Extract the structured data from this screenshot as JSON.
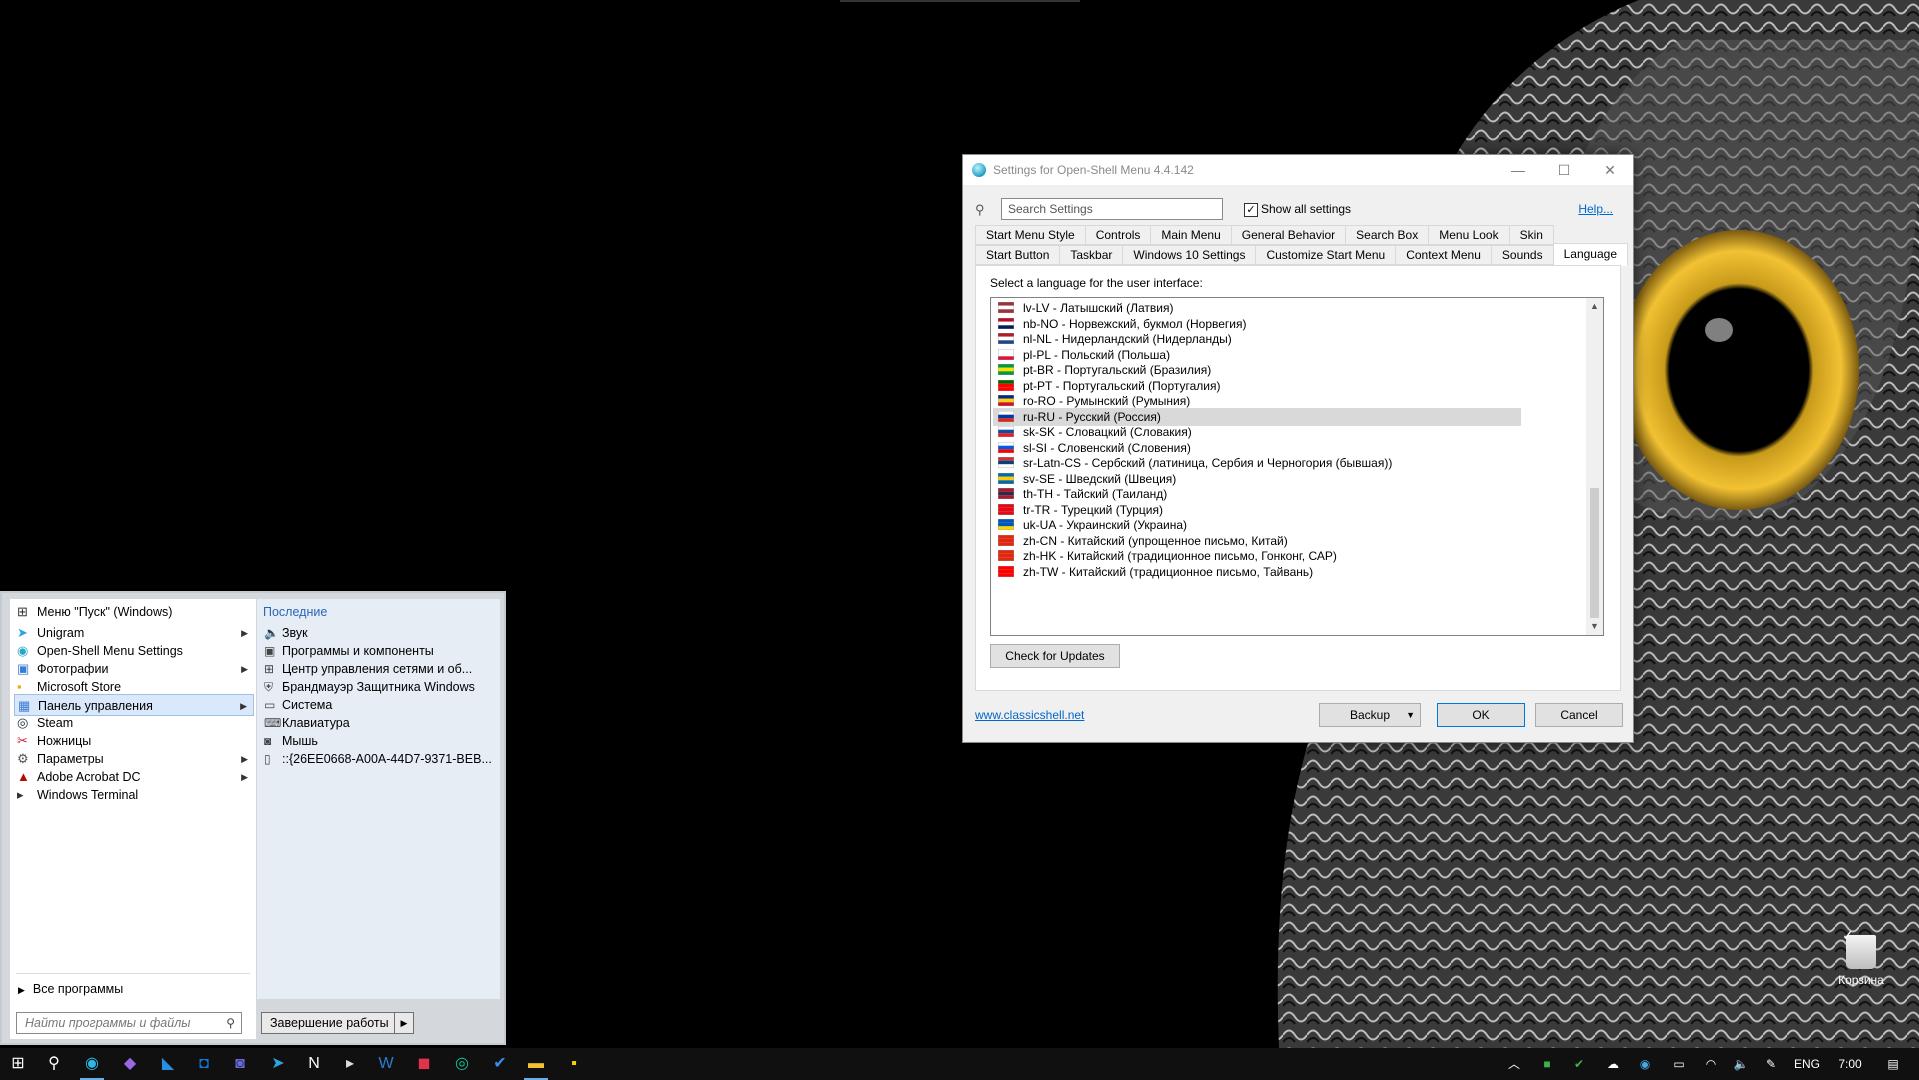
{
  "settings_window": {
    "title": "Settings for Open-Shell Menu 4.4.142",
    "search_placeholder": "Search Settings",
    "show_all_label": "Show all settings",
    "help_link": "Help...",
    "tabs_row1": [
      "Start Menu Style",
      "Controls",
      "Main Menu",
      "General Behavior",
      "Search Box",
      "Menu Look",
      "Skin"
    ],
    "tabs_row2": [
      "Start Button",
      "Taskbar",
      "Windows 10 Settings",
      "Customize Start Menu",
      "Context Menu",
      "Sounds",
      "Language"
    ],
    "active_tab": "Language",
    "panel_label": "Select a language for the user interface:",
    "languages": [
      {
        "text": "lv-LV - Латышский (Латвия)",
        "flag": [
          "#9e3039",
          "#ffffff",
          "#9e3039"
        ]
      },
      {
        "text": "nb-NO - Норвежский, букмол (Норвегия)",
        "flag": [
          "#ba0c2f",
          "#ffffff",
          "#00205b"
        ]
      },
      {
        "text": "nl-NL - Нидерландский (Нидерланды)",
        "flag": [
          "#ae1c28",
          "#ffffff",
          "#21468b"
        ]
      },
      {
        "text": "pl-PL - Польский (Польша)",
        "flag": [
          "#ffffff",
          "#ffffff",
          "#dc143c"
        ]
      },
      {
        "text": "pt-BR - Португальский (Бразилия)",
        "flag": [
          "#009c3b",
          "#ffdf00",
          "#009c3b"
        ]
      },
      {
        "text": "pt-PT - Португальский (Португалия)",
        "flag": [
          "#006600",
          "#ff0000",
          "#ff0000"
        ]
      },
      {
        "text": "ro-RO - Румынский (Румыния)",
        "flag": [
          "#002b7f",
          "#fcd116",
          "#ce1126"
        ]
      },
      {
        "text": "ru-RU - Русский (Россия)",
        "flag": [
          "#ffffff",
          "#0039a6",
          "#d52b1e"
        ]
      },
      {
        "text": "sk-SK - Словацкий (Словакия)",
        "flag": [
          "#ffffff",
          "#0b4ea2",
          "#ee1c25"
        ]
      },
      {
        "text": "sl-SI - Словенский (Словения)",
        "flag": [
          "#ffffff",
          "#005ce5",
          "#ff0000"
        ]
      },
      {
        "text": "sr-Latn-CS - Сербский (латиница, Сербия и Черногория (бывшая))",
        "flag": [
          "#c6363c",
          "#0c4076",
          "#ffffff"
        ]
      },
      {
        "text": "sv-SE - Шведский (Швеция)",
        "flag": [
          "#006aa7",
          "#fecc00",
          "#006aa7"
        ]
      },
      {
        "text": "th-TH - Тайский (Таиланд)",
        "flag": [
          "#a51931",
          "#2d2a4a",
          "#a51931"
        ]
      },
      {
        "text": "tr-TR - Турецкий (Турция)",
        "flag": [
          "#e30a17",
          "#e30a17",
          "#e30a17"
        ]
      },
      {
        "text": "uk-UA - Украинский (Украина)",
        "flag": [
          "#0057b7",
          "#0057b7",
          "#ffd700"
        ]
      },
      {
        "text": "zh-CN - Китайский (упрощенное письмо, Китай)",
        "flag": [
          "#de2910",
          "#de2910",
          "#de2910"
        ]
      },
      {
        "text": "zh-HK - Китайский (традиционное письмо, Гонконг, САР)",
        "flag": [
          "#de2910",
          "#de2910",
          "#de2910"
        ]
      },
      {
        "text": "zh-TW - Китайский (традиционное письмо, Тайвань)",
        "flag": [
          "#fe0000",
          "#fe0000",
          "#fe0000"
        ]
      }
    ],
    "selected_language": "ru-RU - Русский (Россия)",
    "check_updates": "Check for Updates",
    "homepage_link": "www.classicshell.net",
    "backup": "Backup",
    "ok": "OK",
    "cancel": "Cancel"
  },
  "start_menu": {
    "pinned": [
      {
        "label": "Меню \"Пуск\" (Windows)",
        "icon": "windows-start-icon",
        "arrow": false
      },
      {
        "label": "Unigram",
        "icon": "telegram-icon",
        "arrow": true
      },
      {
        "label": "Open-Shell Menu Settings",
        "icon": "open-shell-icon",
        "arrow": false
      },
      {
        "label": "Фотографии",
        "icon": "photos-icon",
        "arrow": true
      },
      {
        "label": "Microsoft Store",
        "icon": "store-icon",
        "arrow": false
      },
      {
        "label": "Панель управления",
        "icon": "control-panel-icon",
        "arrow": true
      },
      {
        "label": "Steam",
        "icon": "steam-icon",
        "arrow": false
      },
      {
        "label": "Ножницы",
        "icon": "snipping-icon",
        "arrow": false
      },
      {
        "label": "Параметры",
        "icon": "gear-icon",
        "arrow": true
      },
      {
        "label": "Adobe Acrobat DC",
        "icon": "acrobat-icon",
        "arrow": true
      },
      {
        "label": "Windows Terminal",
        "icon": "terminal-icon",
        "arrow": false
      }
    ],
    "highlighted": "Панель управления",
    "recent_title": "Последние",
    "recent": [
      {
        "label": "Звук",
        "icon": "speaker-icon"
      },
      {
        "label": "Программы и компоненты",
        "icon": "programs-icon"
      },
      {
        "label": "Центр управления сетями и об...",
        "icon": "network-icon"
      },
      {
        "label": "Брандмауэр Защитника Windows",
        "icon": "firewall-icon"
      },
      {
        "label": "Система",
        "icon": "system-icon"
      },
      {
        "label": "Клавиатура",
        "icon": "keyboard-icon"
      },
      {
        "label": "Мышь",
        "icon": "mouse-icon"
      },
      {
        "label": "::{26EE0668-A00A-44D7-9371-BEB...",
        "icon": "file-icon"
      }
    ],
    "all_programs": "Все программы",
    "search_placeholder": "Найти программы и файлы",
    "shutdown": "Завершение работы"
  },
  "desktop": {
    "recycle_bin": "Корзина"
  },
  "taskbar": {
    "apps": [
      "windows-start-icon",
      "search-icon",
      "edge-icon",
      "visual-studio-icon",
      "vscode-icon",
      "outlook-icon",
      "teams-icon",
      "telegram-icon",
      "notion-icon",
      "terminal-icon",
      "word-icon",
      "jetbrains-icon",
      "grammarly-icon",
      "todo-icon",
      "explorer-icon",
      "sticky-notes-icon"
    ],
    "language": "ENG",
    "time": "7:00"
  },
  "colors": {
    "accent": "#0078d7",
    "link": "#0066cc",
    "recent_title": "#2a66b8"
  }
}
